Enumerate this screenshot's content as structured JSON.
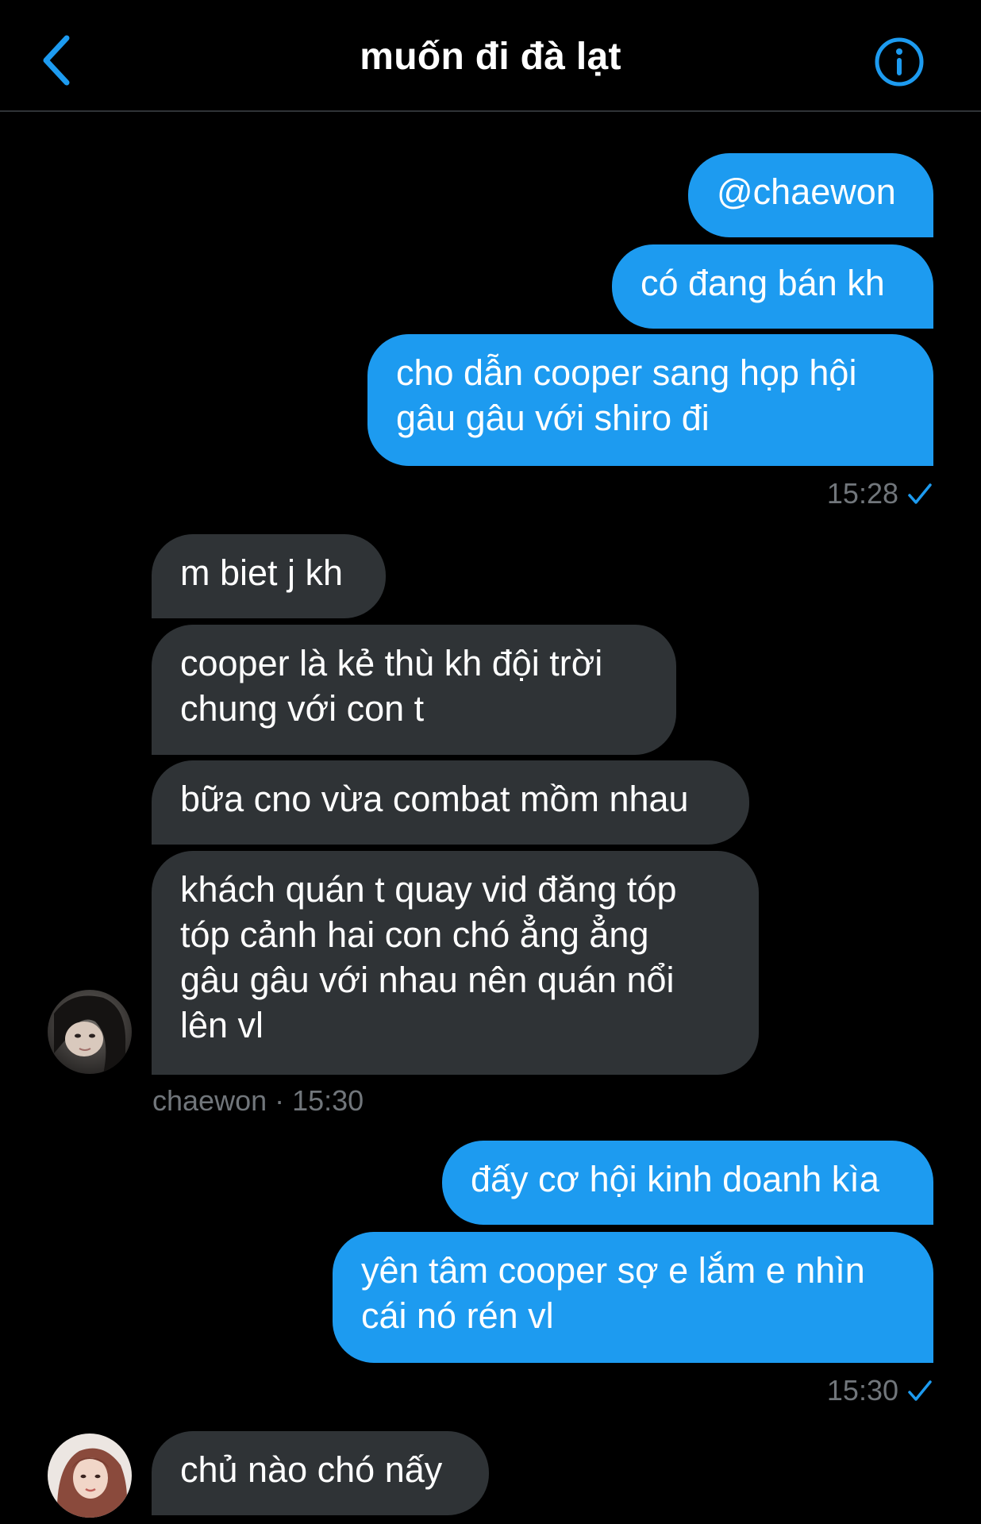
{
  "header": {
    "title": "muốn đi đà lạt"
  },
  "colors": {
    "background": "#000000",
    "outgoing_bubble": "#1d9bf0",
    "incoming_bubble": "#2f3336",
    "accent": "#1d9bf0",
    "meta_text": "#71767b"
  },
  "icons": {
    "back": "chevron-left-icon",
    "info": "info-circle-icon",
    "read": "checkmark-icon"
  },
  "messages": [
    {
      "direction": "out",
      "text": "@chaewon"
    },
    {
      "direction": "out",
      "text": "có đang bán kh"
    },
    {
      "direction": "out",
      "text": "cho dẫn cooper sang họp hội\ngâu gâu với shiro đi"
    },
    {
      "direction": "in",
      "text": "m biet j kh"
    },
    {
      "direction": "in",
      "text": "cooper là kẻ thù kh đội trời\nchung với con t"
    },
    {
      "direction": "in",
      "text": "bữa cno vừa combat mồm nhau"
    },
    {
      "direction": "in",
      "text": "khách quán t quay vid đăng tóp\ntóp cảnh hai con chó ẳng ẳng\ngâu gâu với nhau nên quán nổi\nlên vl"
    },
    {
      "direction": "out",
      "text": "đấy cơ hội kinh doanh kìa"
    },
    {
      "direction": "out",
      "text": "yên tâm cooper sợ e lắm e nhìn\ncái nó rén vl"
    },
    {
      "direction": "in",
      "text": "chủ nào chó nấy"
    }
  ],
  "meta": {
    "group1_time": "15:28",
    "group2_sender_time": "chaewon · 15:30",
    "group3_time": "15:30"
  }
}
